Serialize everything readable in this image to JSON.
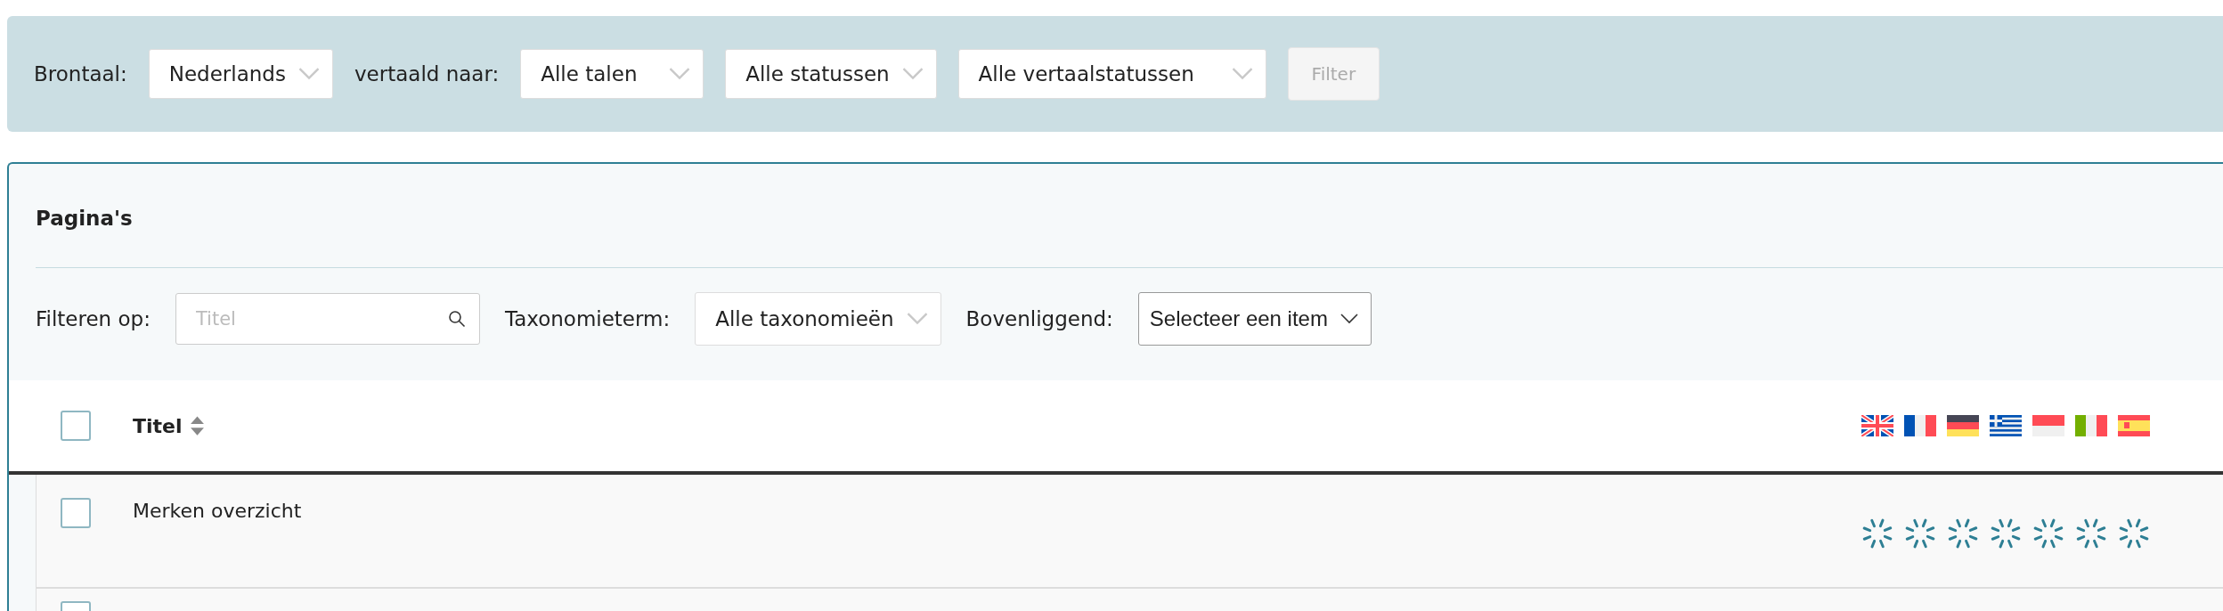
{
  "top_filter": {
    "source_label": "Brontaal:",
    "source_select": "Nederlands",
    "target_label": "vertaald naar:",
    "selects": [
      "Alle talen",
      "Alle statussen",
      "Alle vertaalstatussen"
    ],
    "filter_button": {
      "label": "Filter",
      "disabled": true
    }
  },
  "panel": {
    "title": "Pagina's",
    "filters": {
      "label": "Filteren op:",
      "search": {
        "placeholder": "Titel"
      },
      "taxonomy_label": "Taxonomieterm:",
      "taxonomy_select": "Alle taxonomieën",
      "parent_label": "Bovenliggend:",
      "parent_select": "Selecteer een item"
    },
    "table": {
      "select_all": {
        "checked": false
      },
      "title_column": "Titel",
      "languages": [
        {
          "kind": "gb"
        },
        {
          "kind": "fr"
        },
        {
          "kind": "de"
        },
        {
          "kind": "gr"
        },
        {
          "kind": "id"
        },
        {
          "kind": "it"
        },
        {
          "kind": "es"
        }
      ],
      "rows": [
        {
          "checked": false,
          "title": "Merken overzicht",
          "translations": [
            {
              "loading": true
            },
            {
              "loading": true
            },
            {
              "loading": true
            },
            {
              "loading": true
            },
            {
              "loading": true
            },
            {
              "loading": true
            },
            {
              "loading": true
            }
          ]
        },
        {
          "checked": false
        }
      ]
    }
  }
}
